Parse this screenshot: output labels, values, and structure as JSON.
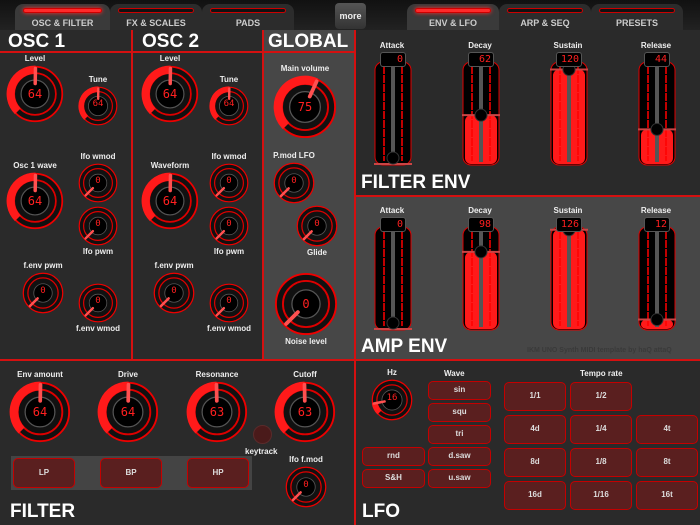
{
  "tabs_left": [
    {
      "label": "OSC & FILTER",
      "active": true
    },
    {
      "label": "FX & SCALES",
      "active": false
    },
    {
      "label": "PADS",
      "active": false
    }
  ],
  "more_label": "more",
  "tabs_right": [
    {
      "label": "ENV & LFO",
      "active": true
    },
    {
      "label": "ARP & SEQ",
      "active": false
    },
    {
      "label": "PRESETS",
      "active": false
    }
  ],
  "colors": {
    "accent": "#ff1a1a",
    "panel": "#2a2a2a",
    "panel_alt": "#474747",
    "line": "#d41010"
  },
  "osc1": {
    "title": "OSC 1",
    "level": {
      "label": "Level",
      "value": "64"
    },
    "tune": {
      "label": "Tune",
      "value": "64"
    },
    "wave": {
      "label": "Osc 1 wave",
      "value": "64"
    },
    "lfo_wmod": {
      "label": "lfo wmod",
      "value": "0"
    },
    "lfo_pwm": {
      "label": "lfo pwm",
      "value": "0"
    },
    "fenv_pwm": {
      "label": "f.env pwm",
      "value": "0"
    },
    "fenv_wmod": {
      "label": "f.env wmod",
      "value": "0"
    }
  },
  "osc2": {
    "title": "OSC 2",
    "level": {
      "label": "Level",
      "value": "64"
    },
    "tune": {
      "label": "Tune",
      "value": "64"
    },
    "wave": {
      "label": "Waveform",
      "value": "64"
    },
    "lfo_wmod": {
      "label": "lfo wmod",
      "value": "0"
    },
    "lfo_pwm": {
      "label": "lfo pwm",
      "value": "0"
    },
    "fenv_pwm": {
      "label": "f.env pwm",
      "value": "0"
    },
    "fenv_wmod": {
      "label": "f.env wmod",
      "value": "0"
    }
  },
  "global": {
    "title": "GLOBAL",
    "main_volume": {
      "label": "Main volume",
      "value": "75"
    },
    "pmod_lfo": {
      "label": "P.mod LFO",
      "value": "0"
    },
    "glide": {
      "label": "Glide",
      "value": "0"
    },
    "noise": {
      "label": "Noise level",
      "value": "0"
    }
  },
  "filter_env": {
    "title": "FILTER ENV",
    "sliders": [
      {
        "label": "Attack",
        "value": "0",
        "max": 127
      },
      {
        "label": "Decay",
        "value": "62",
        "max": 127
      },
      {
        "label": "Sustain",
        "value": "120",
        "max": 127
      },
      {
        "label": "Release",
        "value": "44",
        "max": 127
      }
    ]
  },
  "amp_env": {
    "title": "AMP ENV",
    "sliders": [
      {
        "label": "Attack",
        "value": "0",
        "max": 127
      },
      {
        "label": "Decay",
        "value": "98",
        "max": 127
      },
      {
        "label": "Sustain",
        "value": "126",
        "max": 127
      },
      {
        "label": "Release",
        "value": "12",
        "max": 127
      }
    ],
    "credit": "IKM UNO Synth  MIDI template  by haQ attaQ"
  },
  "filter": {
    "title": "FILTER",
    "env_amount": {
      "label": "Env amount",
      "value": "64"
    },
    "drive": {
      "label": "Drive",
      "value": "64"
    },
    "resonance": {
      "label": "Resonance",
      "value": "63"
    },
    "cutoff": {
      "label": "Cutoff",
      "value": "63"
    },
    "keytrack": "keytrack",
    "lfo_fmod": {
      "label": "lfo f.mod",
      "value": "0"
    },
    "modes": [
      "LP",
      "BP",
      "HP"
    ]
  },
  "lfo": {
    "title": "LFO",
    "hz": {
      "label": "Hz",
      "value": "16"
    },
    "wave_label": "Wave",
    "waves": [
      "sin",
      "squ",
      "tri",
      "d.saw",
      "u.saw"
    ],
    "extra": [
      "rnd",
      "S&H"
    ],
    "tempo_label": "Tempo rate",
    "tempo": [
      [
        "1/1",
        "1/2"
      ],
      [
        "4d",
        "1/4",
        "4t"
      ],
      [
        "8d",
        "1/8",
        "8t"
      ],
      [
        "16d",
        "1/16",
        "16t"
      ]
    ]
  }
}
